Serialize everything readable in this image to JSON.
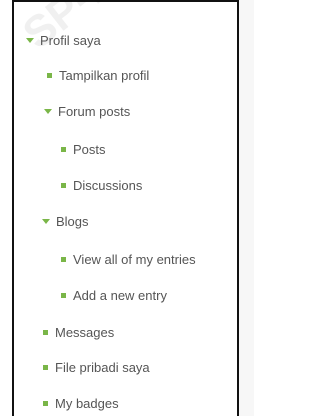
{
  "watermark": "SP-PK",
  "menu": {
    "profile": "Profil saya",
    "view_profile": "Tampilkan profil",
    "forum_posts": "Forum posts",
    "posts": "Posts",
    "discussions": "Discussions",
    "blogs": "Blogs",
    "view_entries": "View all of my entries",
    "add_entry": "Add a new entry",
    "messages": "Messages",
    "private_files": "File pribadi saya",
    "badges": "My badges"
  },
  "colors": {
    "bullet": "#7ab648",
    "text": "#555555"
  }
}
